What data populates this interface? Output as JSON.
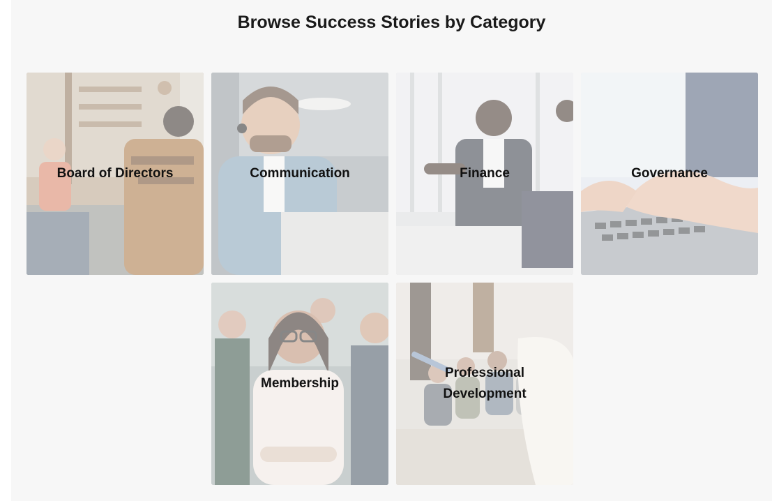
{
  "page": {
    "heading": "Browse Success Stories by Category"
  },
  "categories": [
    {
      "label": "Board of Directors",
      "scene": "group-meeting",
      "tone": "#b9ada0"
    },
    {
      "label": "Communication",
      "scene": "headset-agent",
      "tone": "#b8bcbf"
    },
    {
      "label": "Finance",
      "scene": "business-meeting",
      "tone": "#c4c6ca"
    },
    {
      "label": "Governance",
      "scene": "laptop-typing",
      "tone": "#c8cdd6"
    },
    {
      "label": "Membership",
      "scene": "smiling-woman-crowd",
      "tone": "#b9c0bf"
    },
    {
      "label": "Professional Development",
      "scene": "seminar-presenter",
      "tone": "#cbc4bb"
    }
  ]
}
